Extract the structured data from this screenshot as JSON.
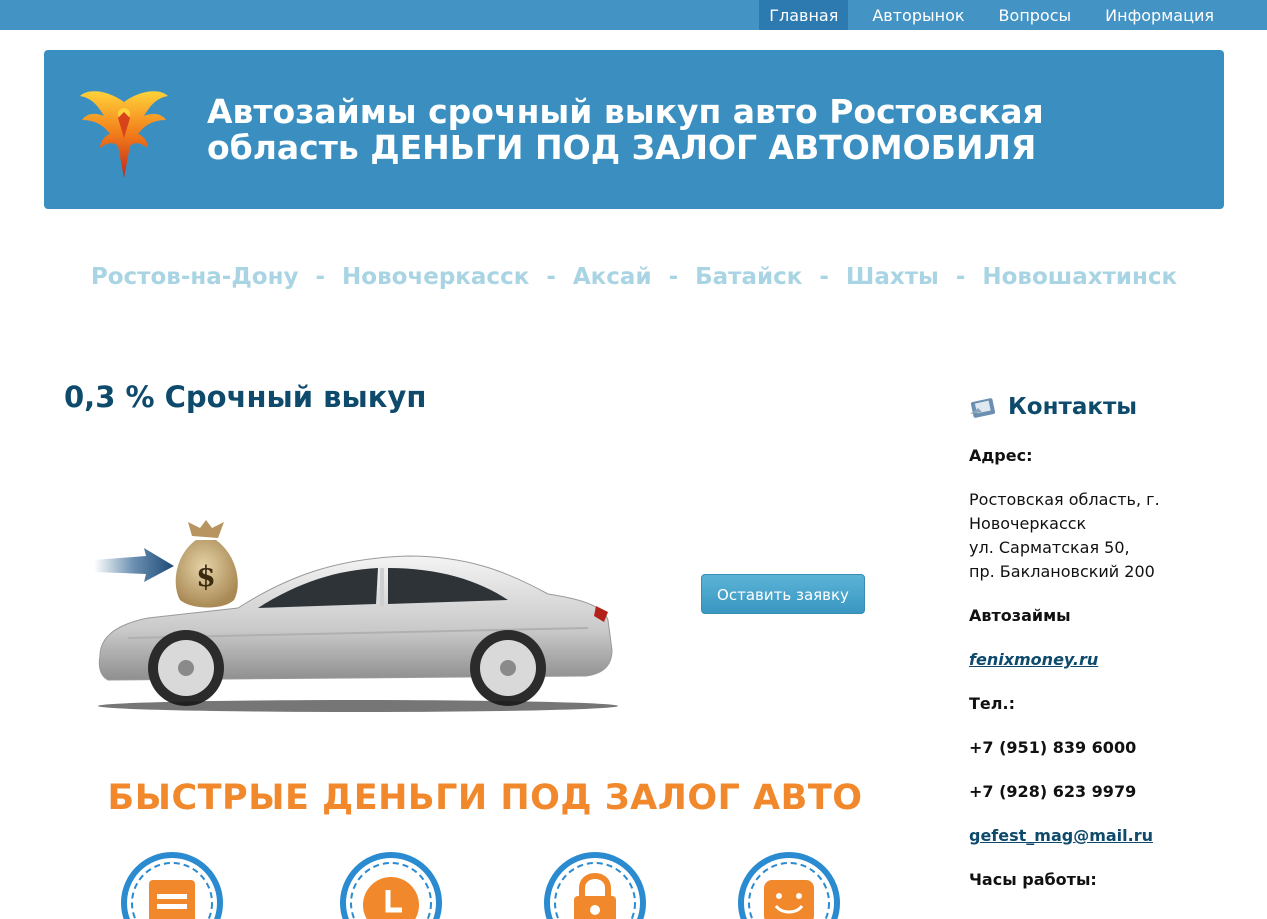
{
  "nav": {
    "items": [
      {
        "label": "Главная",
        "active": true
      },
      {
        "label": "Авторынок"
      },
      {
        "label": "Вопросы"
      },
      {
        "label": "Информация"
      }
    ]
  },
  "header": {
    "title_line1": "Автозаймы срочный выкуп авто Ростовская",
    "title_line2": "область ДЕНЬГИ ПОД ЗАЛОГ АВТОМОБИЛЯ"
  },
  "cities": [
    "Ростов-на-Дону",
    "Новочеркасск",
    "Аксай",
    "Батайск",
    "Шахты",
    "Новошахтинск"
  ],
  "cities_separator": "-",
  "main": {
    "section_title": "0,3 % Срочный выкуп",
    "apply_button": "Оставить заявку",
    "promo_heading": "БЫСТРЫЕ ДЕНЬГИ ПОД ЗАЛОГ АВТО",
    "features": [
      {
        "icon": "document-icon"
      },
      {
        "icon": "clock-icon"
      },
      {
        "icon": "lock-icon"
      },
      {
        "icon": "smile-icon"
      }
    ]
  },
  "sidebar": {
    "title": "Контакты",
    "address_label": "Адрес:",
    "address_line1": "Ростовская область, г.",
    "address_line2": "Новочеркасск",
    "address_line3": "ул. Сарматская 50,",
    "address_line4": "пр. Баклановский 200",
    "loans_label": "Автозаймы",
    "loans_link": "fenixmoney.ru",
    "phone_label": "Тел.:",
    "phone1": "+7 (951) 839 6000",
    "phone2": "+7 (928) 623 9979",
    "email": "gefest_mag@mail.ru",
    "hours_label": "Часы работы:"
  },
  "colors": {
    "nav_bg": "#4393c4",
    "banner_bg": "#3a8fc0",
    "title_dark": "#0e4a6c",
    "cities": "#a8d4e3",
    "promo_orange": "#f1882b",
    "feature_blue": "#2a8bd0"
  }
}
